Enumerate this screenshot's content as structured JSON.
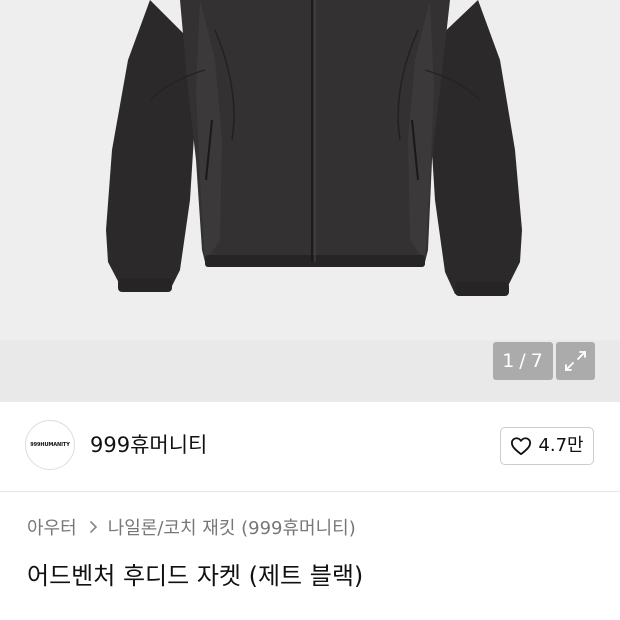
{
  "gallery": {
    "current": "1",
    "separator": "/",
    "total": "7",
    "image_subject": "dark hooded zip jacket"
  },
  "brand": {
    "logo_text": "999HUMANITY",
    "name": "999휴머니티"
  },
  "like": {
    "count": "4.7만",
    "icon": "heart-outline-icon"
  },
  "breadcrumb": {
    "category": "아우터",
    "subcategory": "나일론/코치 재킷 (999휴머니티)"
  },
  "product": {
    "title": "어드벤처 후디드 자켓 (제트 블랙)"
  },
  "colors": {
    "hero_bg": "#eeeeee",
    "jacket": "#2f2d2d",
    "text": "#111111",
    "muted": "#777777"
  }
}
